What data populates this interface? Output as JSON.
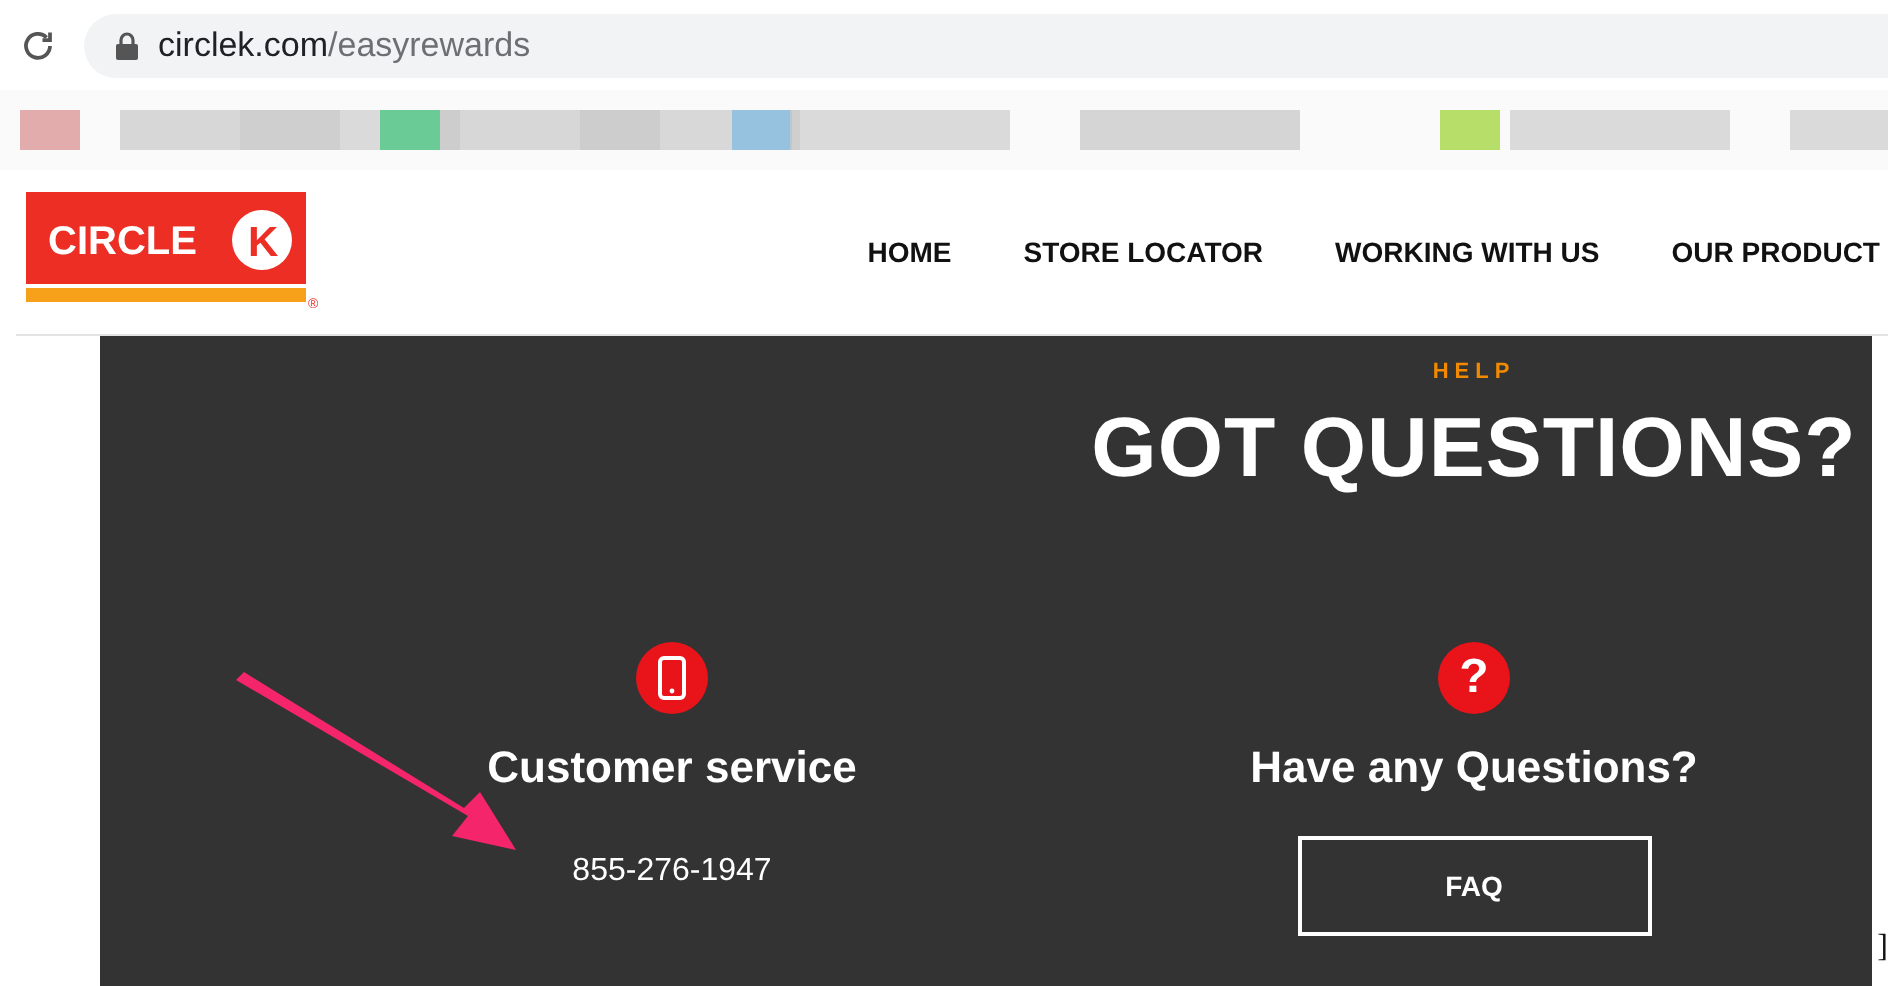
{
  "browser": {
    "url_host": "circlek.com",
    "url_path": "/easyrewards"
  },
  "header": {
    "logo": {
      "text": "CIRCLE",
      "letter": "K",
      "mark": "®"
    },
    "nav": [
      "HOME",
      "STORE LOCATOR",
      "WORKING WITH US",
      "OUR PRODUCT"
    ]
  },
  "help": {
    "eyebrow": "HELP",
    "title": "GOT QUESTIONS?",
    "columns": [
      {
        "kind": "phone",
        "title": "Customer service",
        "text": "855-276-1947"
      },
      {
        "kind": "question",
        "icon_text": "?",
        "title": "Have any Questions?",
        "button": "FAQ"
      }
    ]
  },
  "edge_text": "]"
}
